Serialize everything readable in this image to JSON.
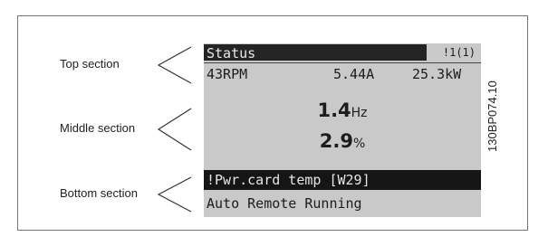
{
  "labels": {
    "top": "Top section",
    "middle": "Middle section",
    "bottom": "Bottom section"
  },
  "display": {
    "status_title": "Status",
    "status_icons": "!1(1)",
    "speed": "43RPM",
    "current": "5.44A",
    "power": "25.3kW",
    "frequency_value": "1.4",
    "frequency_unit": "Hz",
    "percent_value": "2.9",
    "percent_unit": "%",
    "warning": "!Pwr.card temp [W29]",
    "mode": "Auto Remote Running"
  },
  "doc_id": "130BP074.10"
}
